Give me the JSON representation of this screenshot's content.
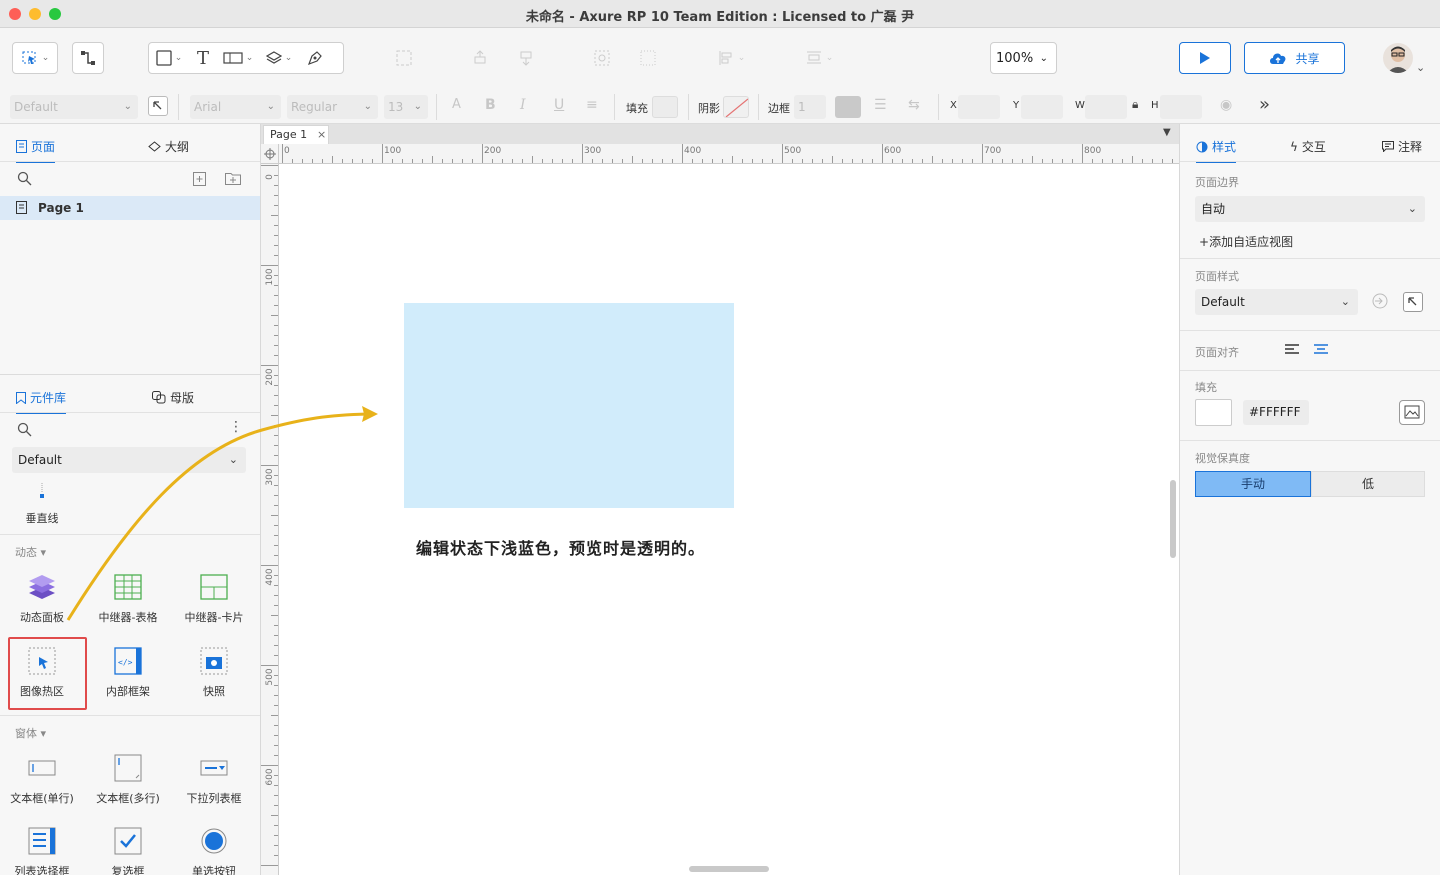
{
  "window": {
    "title": "未命名 - Axure RP 10 Team Edition : Licensed to 广磊 尹"
  },
  "toolbar": {
    "zoom": "100%",
    "share_label": "共享"
  },
  "format_bar": {
    "style": "Default",
    "font": "Arial",
    "weight": "Regular",
    "size": "13",
    "fill_label": "填充",
    "shadow_label": "阴影",
    "border_label": "边框",
    "border_width": "1",
    "x_label": "X",
    "y_label": "Y",
    "w_label": "W",
    "h_label": "H"
  },
  "pages_panel": {
    "tabs": [
      {
        "label": "页面"
      },
      {
        "label": "大纲"
      }
    ],
    "pages": [
      {
        "label": "Page 1"
      }
    ]
  },
  "library_panel": {
    "tabs": [
      {
        "label": "元件库"
      },
      {
        "label": "母版"
      }
    ],
    "library_select": "Default",
    "top_widgets": [
      {
        "label": "垂直线"
      }
    ],
    "sections": [
      {
        "label": "动态",
        "widgets": [
          {
            "label": "动态面板",
            "icon": "dynamic-panel-icon"
          },
          {
            "label": "中继器-表格",
            "icon": "repeater-table-icon"
          },
          {
            "label": "中继器-卡片",
            "icon": "repeater-card-icon"
          },
          {
            "label": "图像热区",
            "icon": "hotspot-icon"
          },
          {
            "label": "内部框架",
            "icon": "inline-frame-icon"
          },
          {
            "label": "快照",
            "icon": "snapshot-icon"
          }
        ]
      },
      {
        "label": "窗体",
        "widgets": [
          {
            "label": "文本框(单行)",
            "icon": "text-field-icon"
          },
          {
            "label": "文本框(多行)",
            "icon": "text-area-icon"
          },
          {
            "label": "下拉列表框",
            "icon": "droplist-icon"
          },
          {
            "label": "列表选择框",
            "icon": "list-box-icon"
          },
          {
            "label": "复选框",
            "icon": "checkbox-icon"
          },
          {
            "label": "单选按钮",
            "icon": "radio-button-icon"
          }
        ]
      }
    ]
  },
  "canvas": {
    "page_tab": "Page 1",
    "ruler_h": [
      "0",
      "100",
      "200",
      "300",
      "400",
      "500",
      "600",
      "700",
      "800"
    ],
    "ruler_v": [
      "0",
      "100",
      "200",
      "300",
      "400",
      "500",
      "600"
    ],
    "caption": "编辑状态下浅蓝色，预览时是透明的。",
    "colors": {
      "hotspot_fill": "#d1ecfb",
      "arrow": "#e8b21a",
      "highlight_box": "#e04b4b"
    }
  },
  "style_panel": {
    "tabs": [
      {
        "label": "样式"
      },
      {
        "label": "交互"
      },
      {
        "label": "注释"
      }
    ],
    "page_dimension_label": "页面边界",
    "page_dimension_value": "自动",
    "add_adaptive_view": "添加自适应视图",
    "page_style_label": "页面样式",
    "page_style_value": "Default",
    "page_align_label": "页面对齐",
    "fill_label": "填充",
    "fill_hex": "#FFFFFF",
    "fidelity_label": "视觉保真度",
    "fidelity_options": [
      {
        "label": "手动"
      },
      {
        "label": "低"
      }
    ]
  },
  "accent_color": "#1a73d9"
}
